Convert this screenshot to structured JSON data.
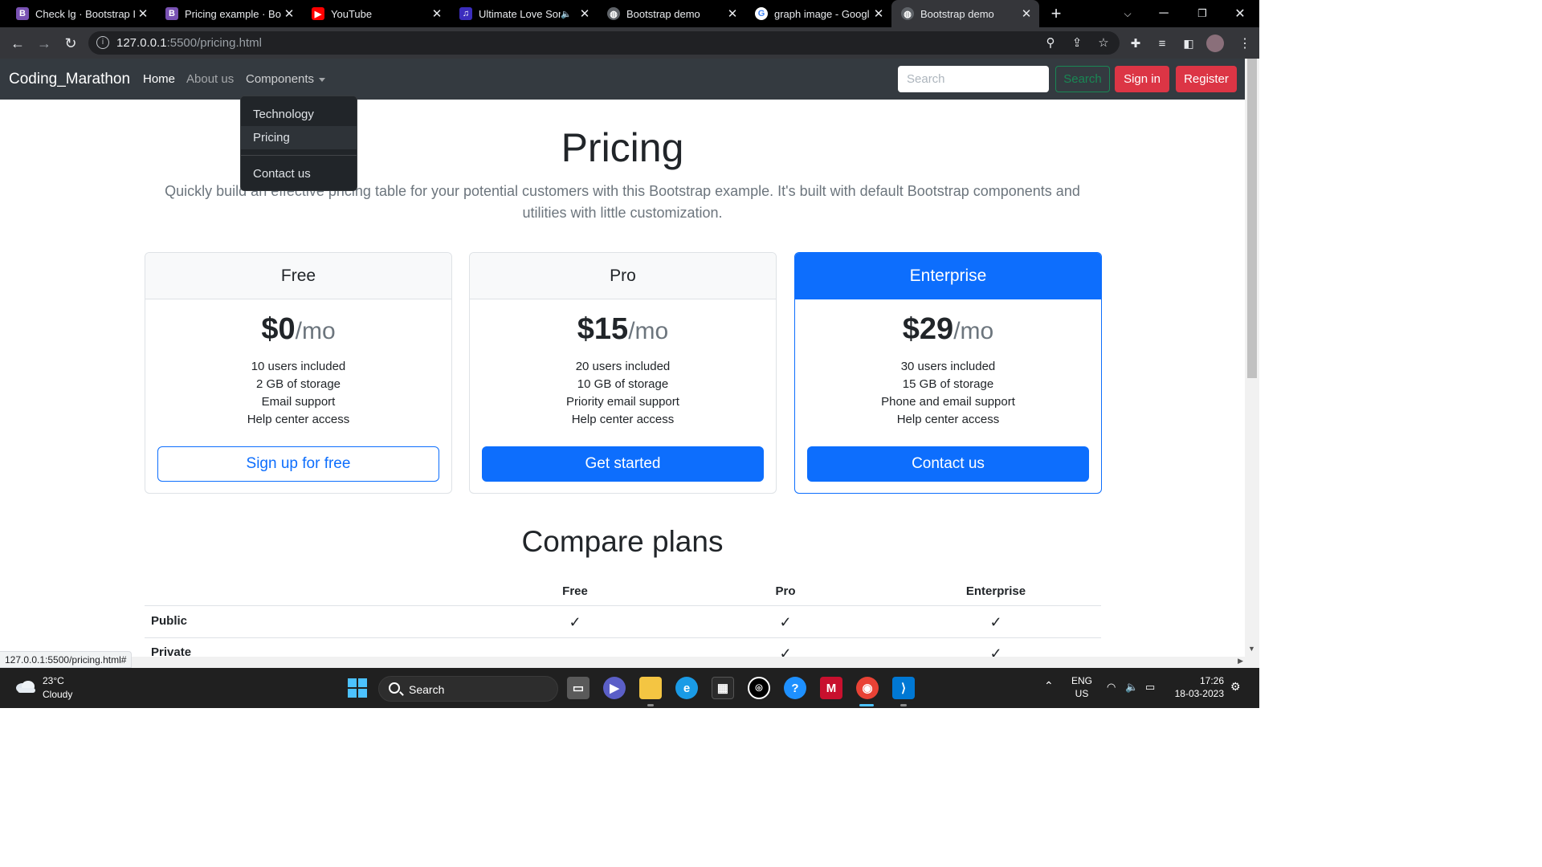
{
  "browser": {
    "tabs": [
      {
        "title": "Check lg · Bootstrap I",
        "favicon": "bootstrap-icon",
        "color": "#7952b3",
        "active": false
      },
      {
        "title": "Pricing example · Boo",
        "favicon": "bootstrap-icon",
        "color": "#7952b3",
        "active": false
      },
      {
        "title": "YouTube",
        "favicon": "youtube-icon",
        "color": "#ff0000",
        "active": false
      },
      {
        "title": "Ultimate Love Sor",
        "favicon": "music-icon",
        "color": "#3b2dbd",
        "active": false,
        "audio": true
      },
      {
        "title": "Bootstrap demo",
        "favicon": "globe-icon",
        "color": "#9aa0a6",
        "active": false
      },
      {
        "title": "graph image - Googl",
        "favicon": "google-icon",
        "color": "#4285f4",
        "active": false
      },
      {
        "title": "Bootstrap demo",
        "favicon": "globe-icon",
        "color": "#9aa0a6",
        "active": true
      }
    ],
    "url_host": "127.0.0.1",
    "url_path": ":5500/pricing.html",
    "status_url": "127.0.0.1:5500/pricing.html#"
  },
  "navbar": {
    "brand": "Coding_Marathon",
    "links": [
      "Home",
      "About us",
      "Components"
    ],
    "search_placeholder": "Search",
    "search_button": "Search",
    "signin": "Sign in",
    "register": "Register"
  },
  "dropdown": {
    "items": [
      "Technology",
      "Pricing",
      "Contact us"
    ]
  },
  "page": {
    "title": "Pricing",
    "lead": "Quickly build an effective pricing table for your potential customers with this Bootstrap example. It's built with default Bootstrap components and utilities with little customization."
  },
  "plans": [
    {
      "name": "Free",
      "price": "$0",
      "per": "/mo",
      "features": [
        "10 users included",
        "2 GB of storage",
        "Email support",
        "Help center access"
      ],
      "button": "Sign up for free"
    },
    {
      "name": "Pro",
      "price": "$15",
      "per": "/mo",
      "features": [
        "20 users included",
        "10 GB of storage",
        "Priority email support",
        "Help center access"
      ],
      "button": "Get started"
    },
    {
      "name": "Enterprise",
      "price": "$29",
      "per": "/mo",
      "features": [
        "30 users included",
        "15 GB of storage",
        "Phone and email support",
        "Help center access"
      ],
      "button": "Contact us"
    }
  ],
  "compare": {
    "title": "Compare plans",
    "columns": [
      "Free",
      "Pro",
      "Enterprise"
    ],
    "rows": [
      {
        "label": "Public",
        "checks": [
          true,
          true,
          true
        ]
      },
      {
        "label": "Private",
        "checks": [
          false,
          true,
          true
        ]
      }
    ]
  },
  "taskbar": {
    "weather_temp": "23°C",
    "weather_desc": "Cloudy",
    "search_label": "Search",
    "lang_top": "ENG",
    "lang_bottom": "US",
    "time": "17:26",
    "date": "18-03-2023"
  },
  "colors": {
    "primary": "#0d6efd",
    "danger": "#dc3545",
    "success": "#198754",
    "navbar": "#343a40"
  }
}
